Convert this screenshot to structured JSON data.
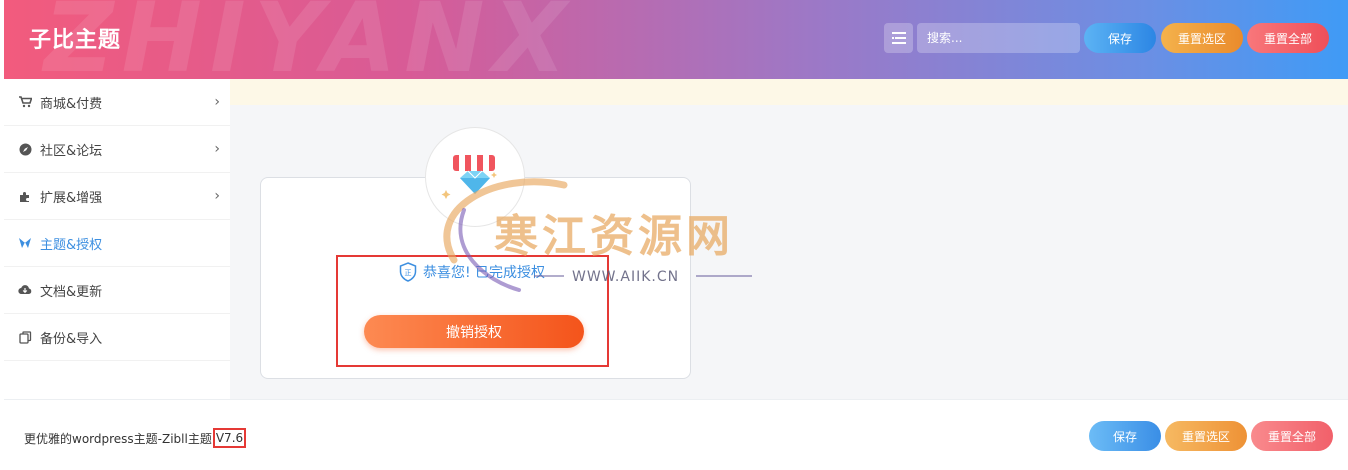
{
  "header": {
    "title": "子比主题",
    "bg_text": "ZHIYANX",
    "search_placeholder": "搜索...",
    "save_label": "保存",
    "reset_section_label": "重置选区",
    "reset_all_label": "重置全部"
  },
  "sidebar": {
    "items": [
      {
        "label": "商城&付费",
        "icon": "cart-icon",
        "has_children": true
      },
      {
        "label": "社区&论坛",
        "icon": "compass-icon",
        "has_children": true
      },
      {
        "label": "扩展&增强",
        "icon": "puzzle-icon",
        "has_children": true
      },
      {
        "label": "主题&授权",
        "icon": "theme-icon",
        "has_children": false,
        "active": true
      },
      {
        "label": "文档&更新",
        "icon": "cloud-icon",
        "has_children": false
      },
      {
        "label": "备份&导入",
        "icon": "copy-icon",
        "has_children": false
      }
    ]
  },
  "card": {
    "auth_status": "恭喜您! 已完成授权",
    "revoke_label": "撤销授权"
  },
  "watermark": {
    "cn": "寒江资源网",
    "en": "WWW.AIIK.CN"
  },
  "footer": {
    "info_text": "更优雅的wordpress主题-Zibll主题",
    "version": "V7.6",
    "save_label": "保存",
    "reset_section_label": "重置选区",
    "reset_all_label": "重置全部"
  },
  "colors": {
    "accent": "#3d8fe0",
    "highlight_border": "#e53935",
    "revoke_button": "#f4541b"
  }
}
